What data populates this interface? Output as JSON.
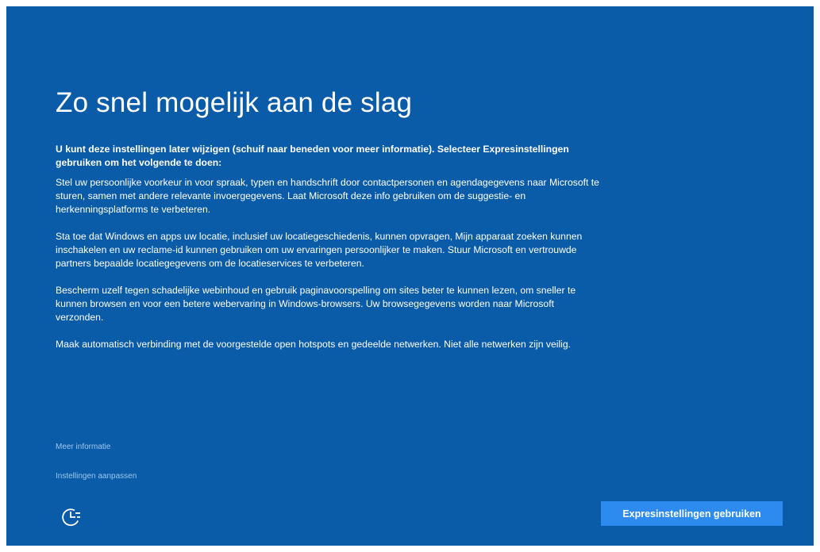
{
  "title": "Zo snel mogelijk aan de slag",
  "intro": "U kunt deze instellingen later wijzigen (schuif naar beneden voor meer informatie). Selecteer Expresinstellingen gebruiken om het volgende te doen:",
  "paragraphs": [
    "Stel uw persoonlijke voorkeur in voor spraak, typen en handschrift door contactpersonen en agendagegevens naar Microsoft te sturen, samen met andere relevante invoergegevens. Laat Microsoft deze info gebruiken om de suggestie- en herkenningsplatforms te verbeteren.",
    "Sta toe dat Windows en apps uw locatie, inclusief uw locatiegeschiedenis, kunnen opvragen, Mijn apparaat zoeken kunnen inschakelen en uw reclame-id kunnen gebruiken om uw ervaringen persoonlijker te maken. Stuur Microsoft en vertrouwde partners bepaalde locatiegegevens om de locatieservices te verbeteren.",
    "Bescherm uzelf tegen schadelijke webinhoud en gebruik paginavoorspelling om sites beter te kunnen lezen, om sneller te kunnen browsen en voor een betere webervaring in Windows-browsers. Uw browsegegevens worden naar Microsoft verzonden.",
    "Maak automatisch verbinding met de voorgestelde open hotspots en gedeelde netwerken. Niet alle netwerken zijn veilig."
  ],
  "links": {
    "more_info": "Meer informatie",
    "customize": "Instellingen aanpassen"
  },
  "buttons": {
    "express": "Expresinstellingen gebruiken"
  },
  "icons": {
    "accessibility": "ease-of-access-icon"
  },
  "colors": {
    "background": "#0a5ba8",
    "button": "#2d8bf0",
    "link": "#9cc8ee"
  }
}
